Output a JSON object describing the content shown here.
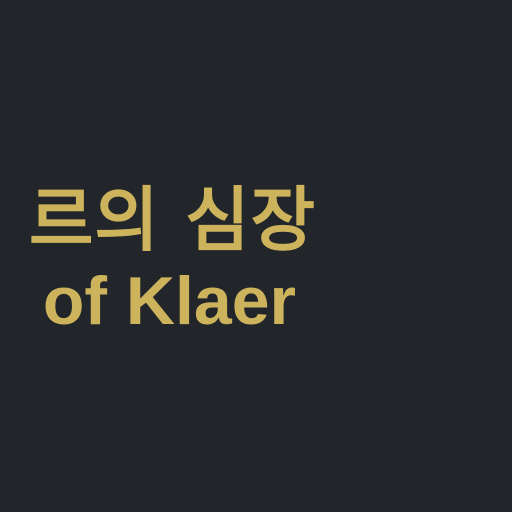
{
  "screen": {
    "background_color": "#22262b",
    "accent_color": "#cdb45c"
  },
  "title": {
    "korean": "르의 심장",
    "english": "of Klaer"
  }
}
